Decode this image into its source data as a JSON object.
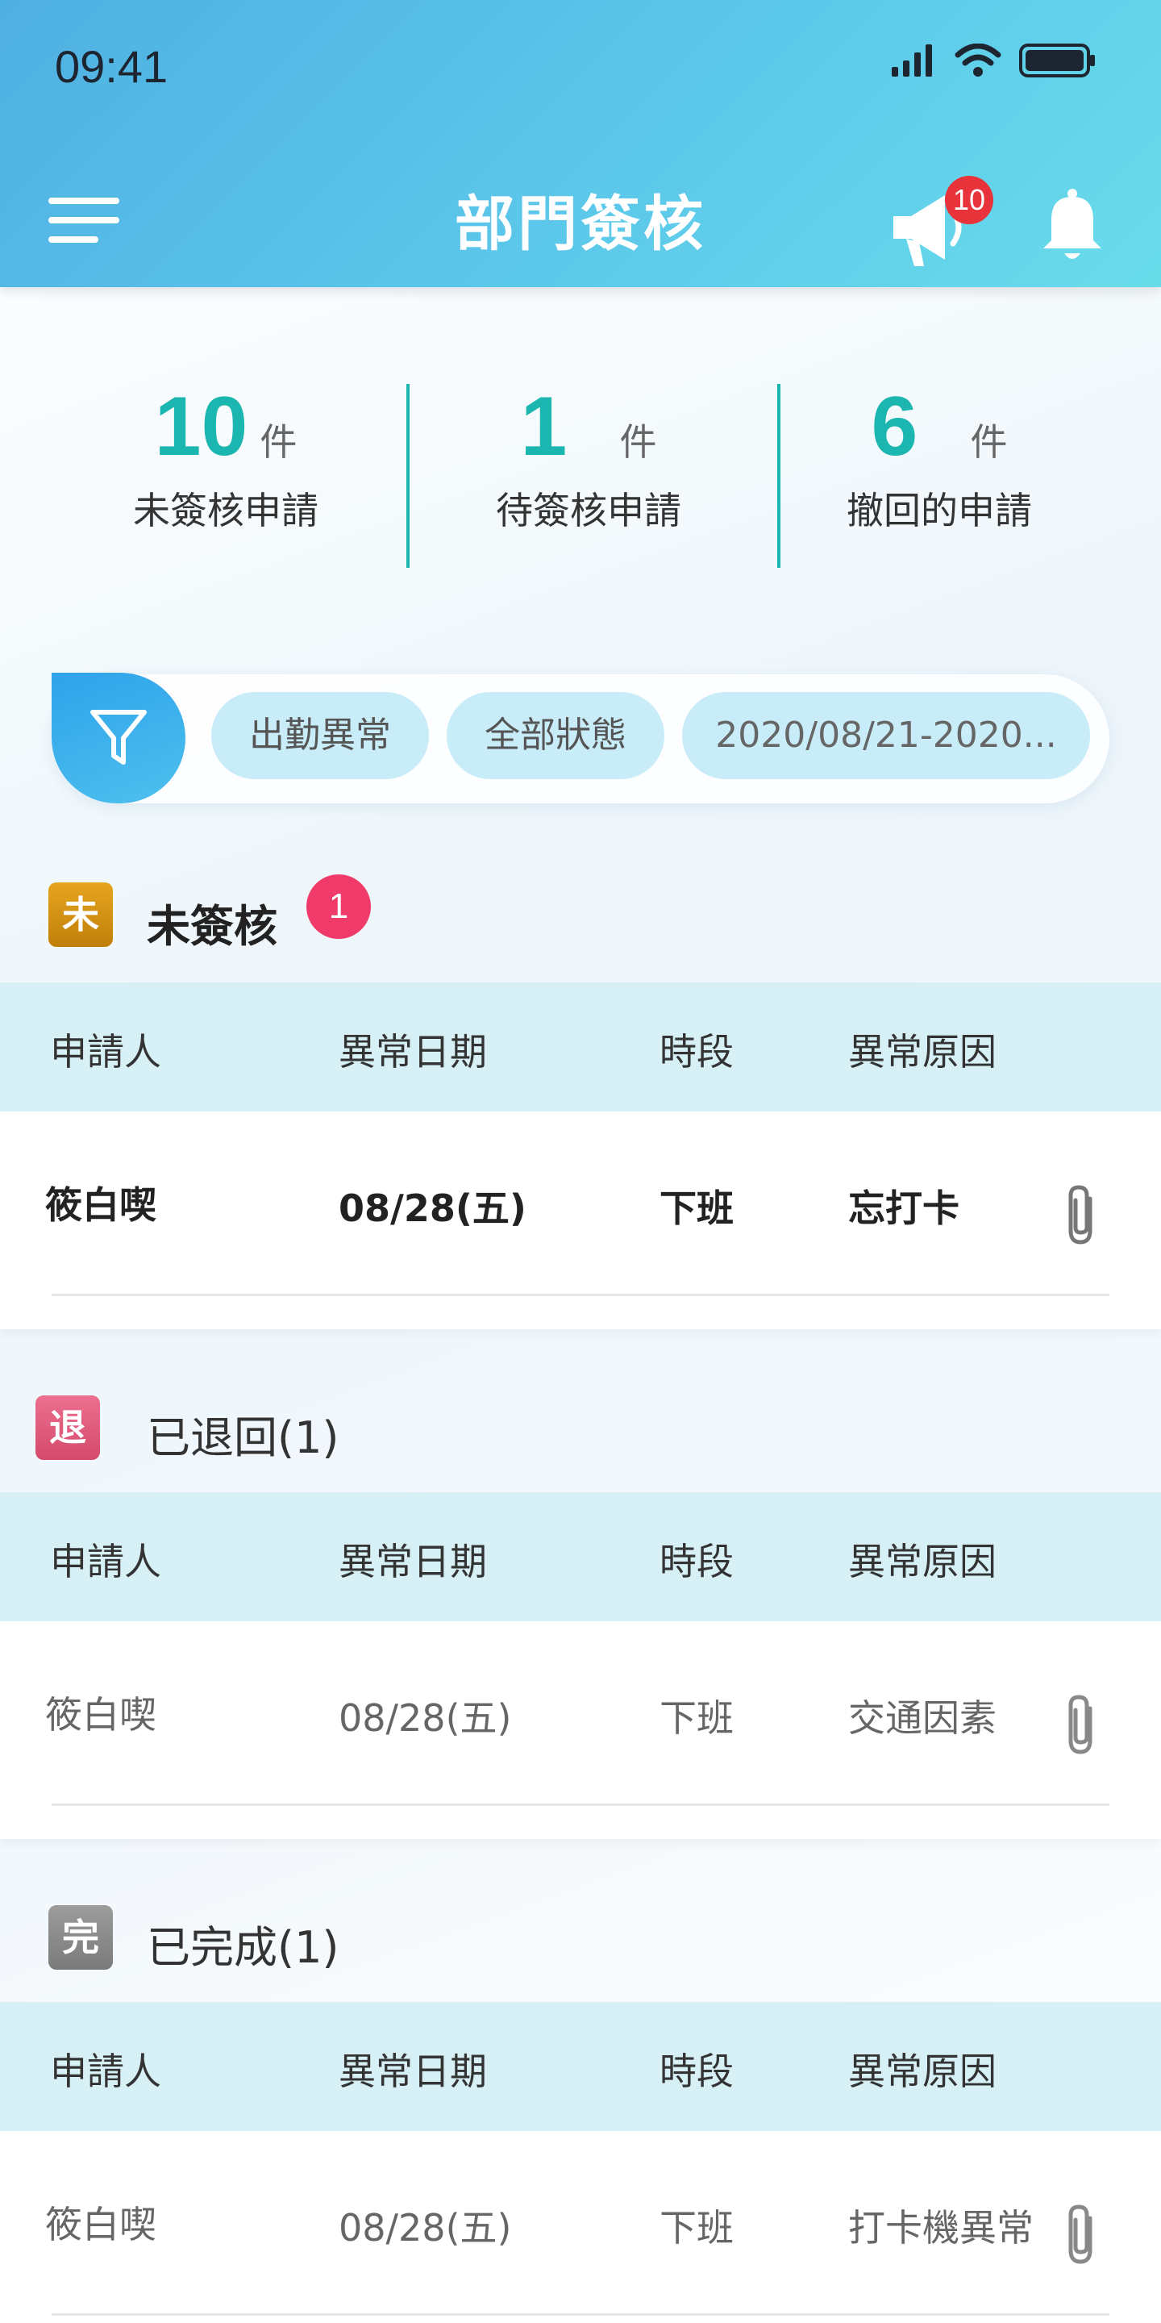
{
  "status_bar": {
    "time": "09:41"
  },
  "header": {
    "title": "部門簽核",
    "announce_badge": "10"
  },
  "stats": [
    {
      "value": "10",
      "unit": "件",
      "label": "未簽核申請"
    },
    {
      "value": "1",
      "unit": "件",
      "label": "待簽核申請"
    },
    {
      "value": "6",
      "unit": "件",
      "label": "撤回的申請"
    }
  ],
  "filters": {
    "chips": [
      "出勤異常",
      "全部狀態",
      "2020/08/21-2020..."
    ]
  },
  "columns": [
    "申請人",
    "異常日期",
    "時段",
    "異常原因"
  ],
  "sections": [
    {
      "badge": "未",
      "badge_color": "#d08f0e",
      "title": "未簽核",
      "count_badge": "1",
      "row": {
        "name": "筱白喫",
        "date": "08/28(五)",
        "period": "下班",
        "reason": "忘打卡"
      }
    },
    {
      "badge": "退",
      "badge_color": "#e0577a",
      "title": "已退回(1)",
      "row": {
        "name": "筱白喫",
        "date": "08/28(五)",
        "period": "下班",
        "reason": "交通因素"
      }
    },
    {
      "badge": "完",
      "badge_color": "#8a8a8a",
      "title": "已完成(1)",
      "row": {
        "name": "筱白喫",
        "date": "08/28(五)",
        "period": "下班",
        "reason": "打卡機異常"
      }
    }
  ]
}
